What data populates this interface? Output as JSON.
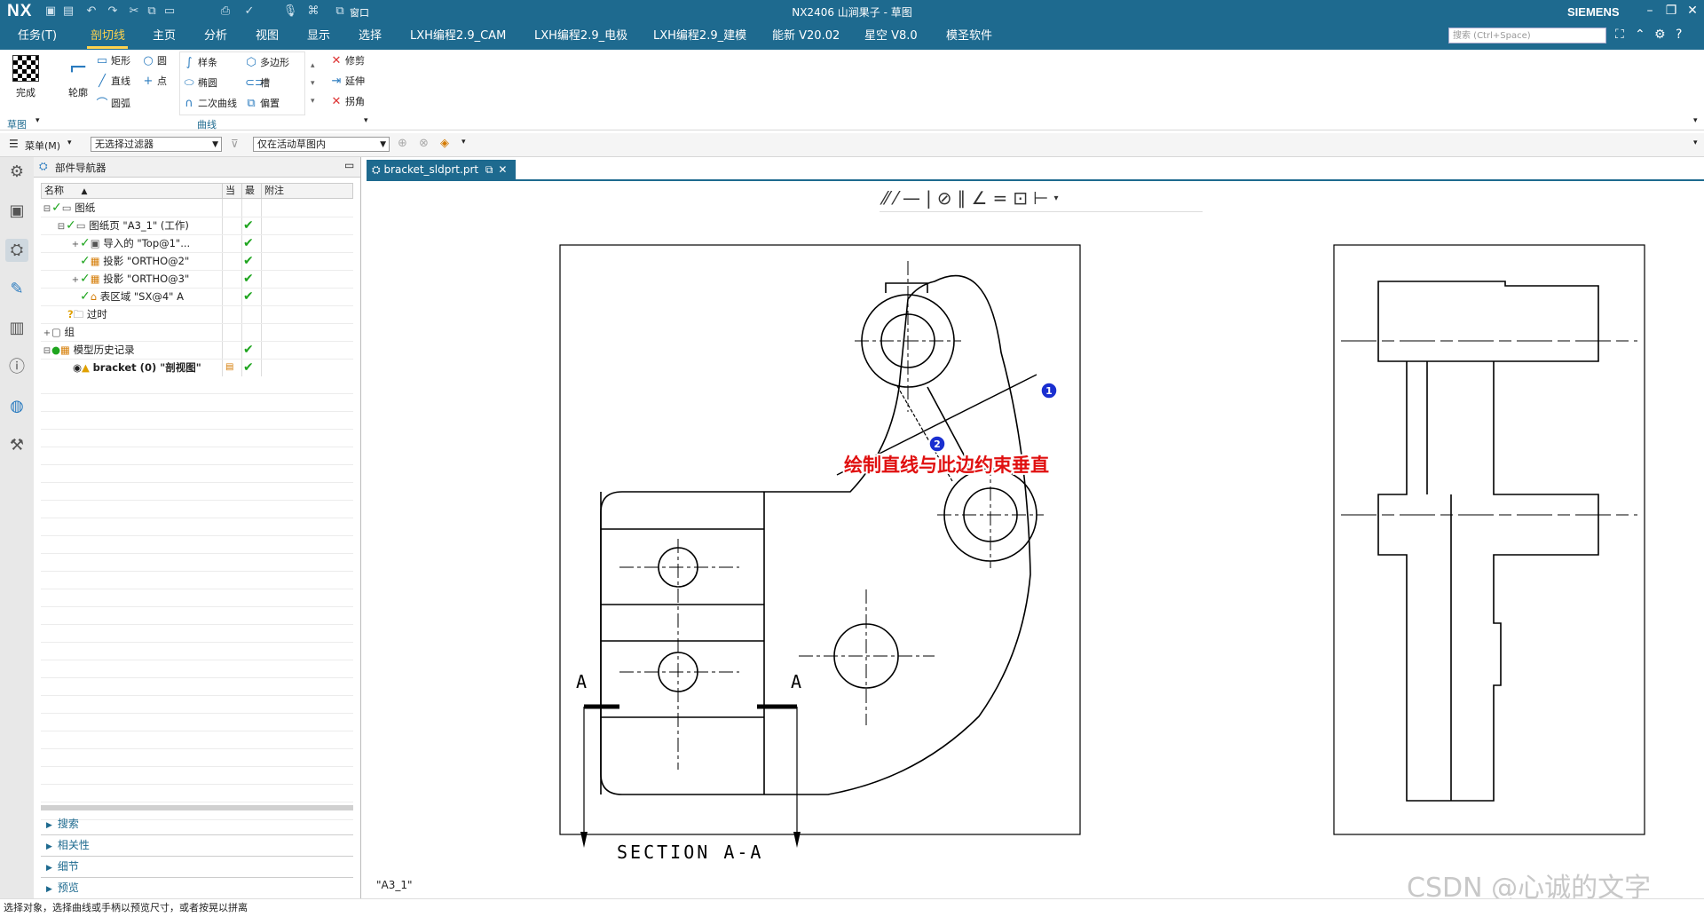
{
  "app": {
    "logo": "NX",
    "window_title": "NX2406 山涧果子 - 草图",
    "brand": "SIEMENS",
    "quick_access": {
      "window_label": "窗口"
    }
  },
  "menu": {
    "tabs": [
      "任务(T)",
      "剖切线",
      "主页",
      "分析",
      "视图",
      "显示",
      "选择",
      "LXH编程2.9_CAM",
      "LXH编程2.9_电极",
      "LXH编程2.9_建模",
      "能新 V20.02",
      "星空 V8.0",
      "模圣软件"
    ],
    "active_tab": "剖切线",
    "search_placeholder": "搜索 (Ctrl+Space)"
  },
  "ribbon": {
    "finish_label": "完成",
    "profile_label": "轮廓",
    "group_sketch_label": "草图",
    "group_curve_label": "曲线",
    "tools_col1": [
      "矩形",
      "直线",
      "圆弧"
    ],
    "tools_col2": [
      "圆",
      "点"
    ],
    "tools_col3": [
      "样条",
      "椭圆",
      "二次曲线"
    ],
    "tools_col4": [
      "多边形",
      "槽",
      "偏置"
    ],
    "tools_col5": [
      "修剪",
      "延伸",
      "拐角"
    ]
  },
  "toolbar2": {
    "menu_label": "菜单(M)",
    "filter_value": "无选择过滤器",
    "scope_value": "仅在活动草图内"
  },
  "navigator": {
    "title": "部件导航器",
    "columns": [
      "名称",
      "当",
      "最",
      "附注"
    ],
    "rows": [
      {
        "label": "图纸",
        "current": "",
        "latest": ""
      },
      {
        "label": "图纸页 \"A3_1\" (工作)",
        "current": "",
        "latest": "✔"
      },
      {
        "label": "导入的 \"Top@1\"...",
        "current": "",
        "latest": "✔"
      },
      {
        "label": "投影 \"ORTHO@2\"",
        "current": "",
        "latest": "✔"
      },
      {
        "label": "投影 \"ORTHO@3\"",
        "current": "",
        "latest": "✔"
      },
      {
        "label": "表区域 \"SX@4\" A",
        "current": "",
        "latest": "✔"
      },
      {
        "label": "过时",
        "current": "",
        "latest": ""
      },
      {
        "label": "组",
        "current": "",
        "latest": ""
      },
      {
        "label": "模型历史记录",
        "current": "",
        "latest": "✔"
      },
      {
        "label": "bracket (0) \"剖视图\"",
        "current": "",
        "latest": "✔"
      }
    ],
    "sections": [
      "搜索",
      "相关性",
      "细节",
      "预览"
    ]
  },
  "document": {
    "tab_label": "bracket_sldprt.prt",
    "sheet_name": "\"A3_1\"",
    "section_title": "SECTION  A-A",
    "section_letter_left": "A",
    "section_letter_right": "A",
    "callout_1": "1",
    "callout_2": "2",
    "annotation": "绘制直线与此边约束垂直"
  },
  "status_bar": "选择对象，选择曲线或手柄以预览尺寸，或者按晃以拼离",
  "watermark": "CSDN @心诚的文字",
  "colors": {
    "titlebar": "#1e6a8f",
    "active_tab": "#ffd34d",
    "check": "#1fa51f",
    "annotation": "#e01010",
    "callout": "#1a2fd0"
  }
}
